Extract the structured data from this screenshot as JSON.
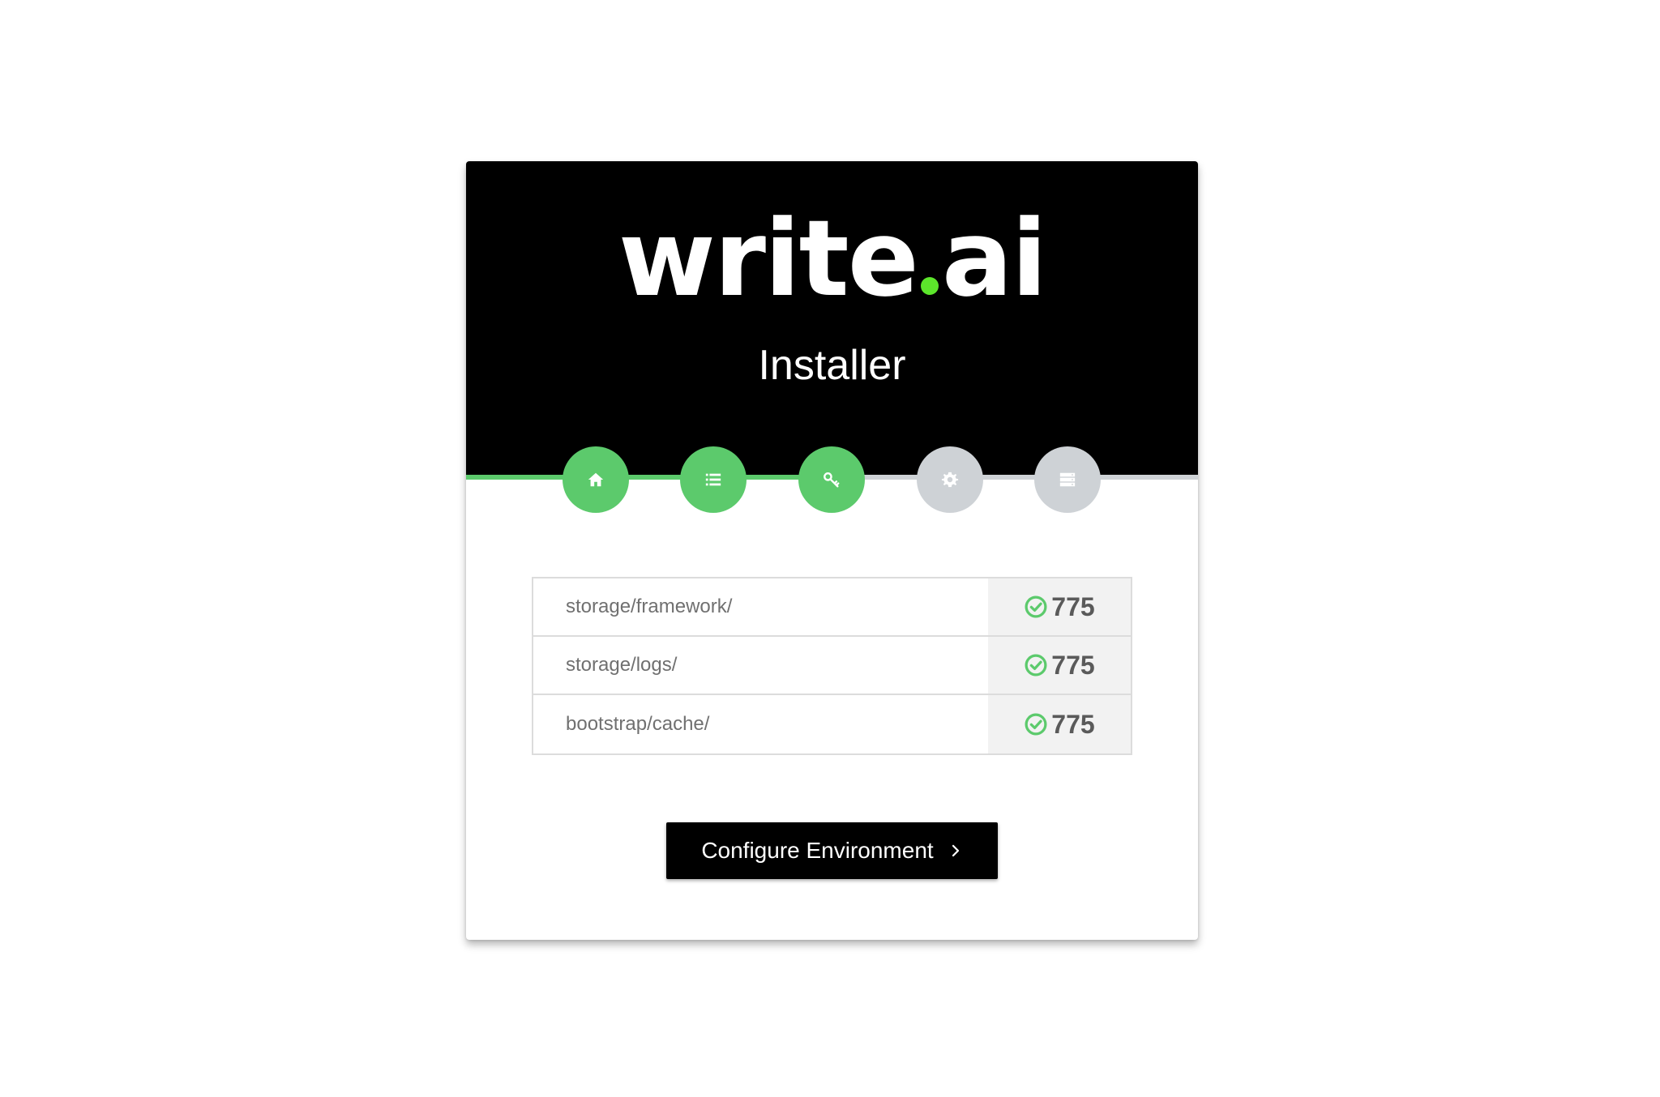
{
  "header": {
    "logo_main": "write",
    "logo_suffix": "ai",
    "logo_dot_color": "#5ce62b",
    "title": "Installer"
  },
  "steps": [
    {
      "icon": "home-icon",
      "status": "complete"
    },
    {
      "icon": "list-icon",
      "status": "complete"
    },
    {
      "icon": "key-icon",
      "status": "complete"
    },
    {
      "icon": "gear-icon",
      "status": "pending"
    },
    {
      "icon": "server-icon",
      "status": "pending"
    }
  ],
  "colors": {
    "complete": "#5cca6c",
    "pending": "#ced2d6"
  },
  "permissions": [
    {
      "path": "storage/framework/",
      "value": "775",
      "status": "ok"
    },
    {
      "path": "storage/logs/",
      "value": "775",
      "status": "ok"
    },
    {
      "path": "bootstrap/cache/",
      "value": "775",
      "status": "ok"
    }
  ],
  "button": {
    "label": "Configure Environment",
    "icon": "chevron-right-icon"
  }
}
